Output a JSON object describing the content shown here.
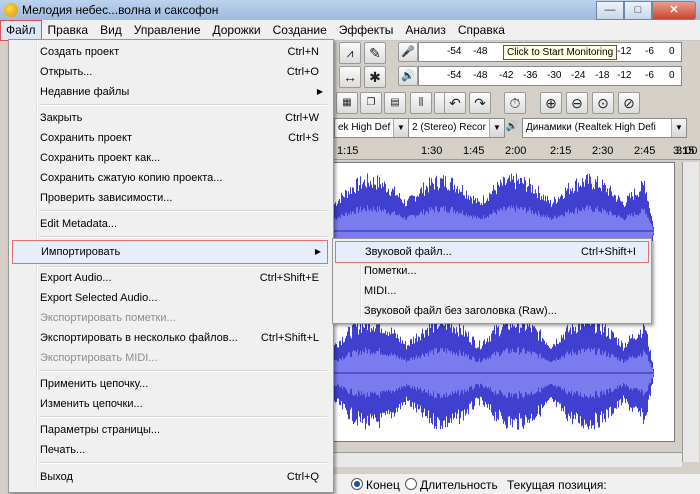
{
  "window": {
    "title": "Мелодия небес...волна и саксофон",
    "minimize": "—",
    "maximize": "□",
    "close": "✕"
  },
  "menubar": [
    "Файл",
    "Правка",
    "Вид",
    "Управление",
    "Дорожки",
    "Создание",
    "Эффекты",
    "Анализ",
    "Справка"
  ],
  "meters": {
    "rec_ticks": [
      "-54",
      "-48",
      "-12",
      "-6",
      "0"
    ],
    "play_ticks": [
      "-54",
      "-48",
      "-42",
      "-36",
      "-30",
      "-24",
      "-18",
      "-12",
      "-6",
      "0"
    ],
    "tooltip": "Click to Start Monitoring"
  },
  "devices": {
    "input": "ek High Def",
    "channels": "2 (Stereo) Recor",
    "output": "Динамики (Realtek High Defi"
  },
  "ruler": [
    "1:15",
    "1:30",
    "1:45",
    "2:00",
    "2:15",
    "2:30",
    "2:45",
    "3:00",
    "3:15"
  ],
  "statusbar": {
    "end_label": "Конец",
    "length_label": "Длительность",
    "position_label": "Текущая позиция:"
  },
  "file_menu": [
    {
      "label": "Создать проект",
      "shortcut": "Ctrl+N"
    },
    {
      "label": "Открыть...",
      "shortcut": "Ctrl+O"
    },
    {
      "label": "Недавние файлы",
      "shortcut": ""
    },
    {
      "label": "Закрыть",
      "shortcut": "Ctrl+W"
    },
    {
      "label": "Сохранить проект",
      "shortcut": "Ctrl+S"
    },
    {
      "label": "Сохранить проект как...",
      "shortcut": ""
    },
    {
      "label": "Сохранить сжатую копию проекта...",
      "shortcut": ""
    },
    {
      "label": "Проверить зависимости...",
      "shortcut": ""
    },
    {
      "label": "Edit Metadata...",
      "shortcut": ""
    },
    {
      "label": "Импортировать",
      "shortcut": ""
    },
    {
      "label": "Export Audio...",
      "shortcut": "Ctrl+Shift+E"
    },
    {
      "label": "Export Selected Audio...",
      "shortcut": ""
    },
    {
      "label": "Экспортировать пометки...",
      "shortcut": ""
    },
    {
      "label": "Экспортировать в несколько файлов...",
      "shortcut": "Ctrl+Shift+L"
    },
    {
      "label": "Экспортировать MIDI...",
      "shortcut": ""
    },
    {
      "label": "Применить цепочку...",
      "shortcut": ""
    },
    {
      "label": "Изменить цепочки...",
      "shortcut": ""
    },
    {
      "label": "Параметры страницы...",
      "shortcut": ""
    },
    {
      "label": "Печать...",
      "shortcut": ""
    },
    {
      "label": "Выход",
      "shortcut": "Ctrl+Q"
    }
  ],
  "import_submenu": [
    {
      "label": "Звуковой файл...",
      "shortcut": "Ctrl+Shift+I"
    },
    {
      "label": "Пометки...",
      "shortcut": ""
    },
    {
      "label": "MIDI...",
      "shortcut": ""
    },
    {
      "label": "Звуковой файл без заголовка (Raw)...",
      "shortcut": ""
    }
  ],
  "colors": {
    "waveform": "#3f3fd0",
    "waveform_light": "#7b7bf0"
  },
  "icons": [
    "app-icon",
    "pencil-icon",
    "mic-icon",
    "speaker-icon",
    "resize-icon",
    "multi-tool-icon",
    "undo-icon",
    "redo-icon",
    "timer-icon",
    "zoom-in-icon",
    "zoom-out-icon",
    "fit-selection-icon",
    "fit-project-icon",
    "submenu-arrow-icon"
  ]
}
